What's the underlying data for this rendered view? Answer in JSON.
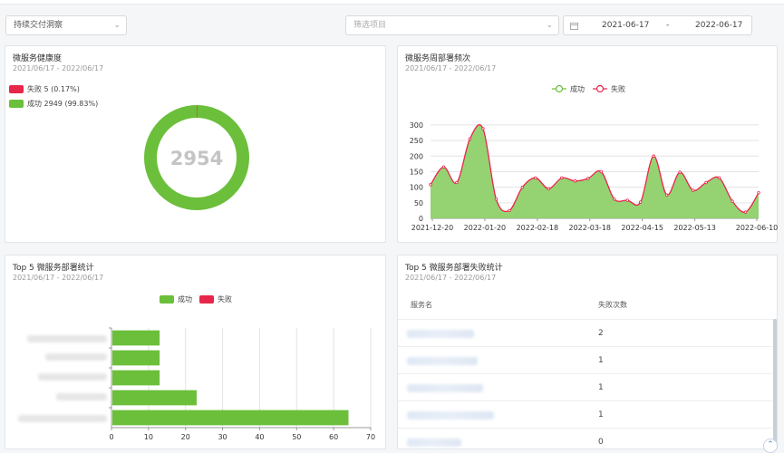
{
  "filters": {
    "category_select": "持续交付洞察",
    "project_placeholder": "筛选项目",
    "date_start": "2021-06-17",
    "date_sep": "-",
    "date_end": "2022-06-17"
  },
  "health": {
    "title": "微服务健康度",
    "subtitle": "2021/06/17 - 2022/06/17",
    "legend": [
      {
        "label": "失败 5 (0.17%)",
        "color": "#e8264b"
      },
      {
        "label": "成功 2949 (99.83%)",
        "color": "#6bbf3a"
      }
    ],
    "total": "2954",
    "fail": 5,
    "success": 2949
  },
  "weekly": {
    "title": "微服务周部署频次",
    "subtitle": "2021/06/17 - 2022/06/17",
    "legend_success": "成功",
    "legend_fail": "失败",
    "chart_data": {
      "type": "area",
      "x_ticks": [
        "2021-12-20",
        "2022-01-20",
        "2022-02-18",
        "2022-03-18",
        "2022-04-15",
        "2022-05-13",
        "2022-06-10"
      ],
      "y_ticks": [
        0,
        50,
        100,
        150,
        200,
        250,
        300
      ],
      "ylim": [
        0,
        320
      ],
      "x_index": [
        0,
        1,
        2,
        3,
        4,
        5,
        6,
        7,
        8,
        9,
        10,
        11,
        12,
        13,
        14,
        15,
        16,
        17,
        18,
        19,
        20,
        21,
        22,
        23,
        24,
        25
      ],
      "series": [
        {
          "name": "成功",
          "color": "#6bbf3a",
          "values": [
            108,
            165,
            115,
            255,
            288,
            62,
            25,
            100,
            130,
            95,
            130,
            120,
            128,
            150,
            62,
            58,
            52,
            200,
            75,
            148,
            90,
            115,
            130,
            55,
            20,
            82
          ]
        },
        {
          "name": "失败",
          "color": "#e8264b",
          "values": [
            0,
            0,
            0,
            0,
            0,
            0,
            0,
            0,
            0,
            0,
            0,
            0,
            0,
            0,
            0,
            0,
            0,
            0,
            0,
            0,
            0,
            0,
            0,
            0,
            0,
            0
          ]
        }
      ]
    }
  },
  "top5": {
    "title": "Top 5 微服务部署统计",
    "subtitle": "2021/06/17 - 2022/06/17",
    "legend_success": "成功",
    "legend_fail": "失败",
    "chart_data": {
      "type": "bar",
      "orientation": "horizontal",
      "series": [
        {
          "name": "成功",
          "color": "#6bbf3a",
          "values": [
            13,
            13,
            13,
            23,
            64
          ]
        },
        {
          "name": "失败",
          "color": "#e8264b",
          "values": [
            0,
            0,
            0,
            0,
            0
          ]
        }
      ],
      "x_ticks": [
        0,
        10,
        20,
        30,
        40,
        50,
        60,
        70
      ],
      "xlim": [
        0,
        70
      ]
    }
  },
  "failures": {
    "title": "Top 5 微服务部署失败统计",
    "subtitle": "2021/06/17 - 2022/06/17",
    "col_service": "服务名",
    "col_count": "失败次数",
    "counts": [
      "2",
      "1",
      "1",
      "1",
      "0"
    ]
  }
}
